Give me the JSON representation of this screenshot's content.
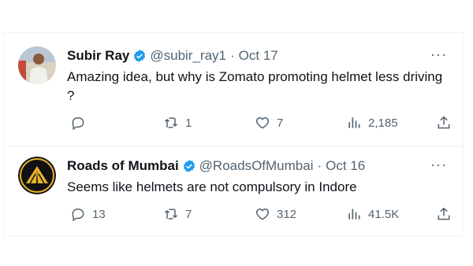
{
  "tweets": [
    {
      "name": "Subir Ray",
      "handle": "@subir_ray1",
      "separator": "·",
      "date": "Oct 17",
      "text": "Amazing idea, but why is Zomato promoting helmet less driving ?",
      "replies": "",
      "retweets": "1",
      "likes": "7",
      "views": "2,185",
      "more": "···",
      "avatar_icon": "person-photo-icon"
    },
    {
      "name": "Roads of Mumbai",
      "handle": "@RoadsOfMumbai",
      "separator": "·",
      "date": "Oct 16",
      "text": "Seems like helmets are not compulsory in Indore",
      "replies": "13",
      "retweets": "7",
      "likes": "312",
      "views": "41.5K",
      "more": "···",
      "avatar_icon": "road-logo-icon"
    }
  ],
  "colors": {
    "verified": "#1d9bf0",
    "secondary_text": "#536471",
    "primary_text": "#0f1419",
    "divider": "#eff3f4"
  }
}
